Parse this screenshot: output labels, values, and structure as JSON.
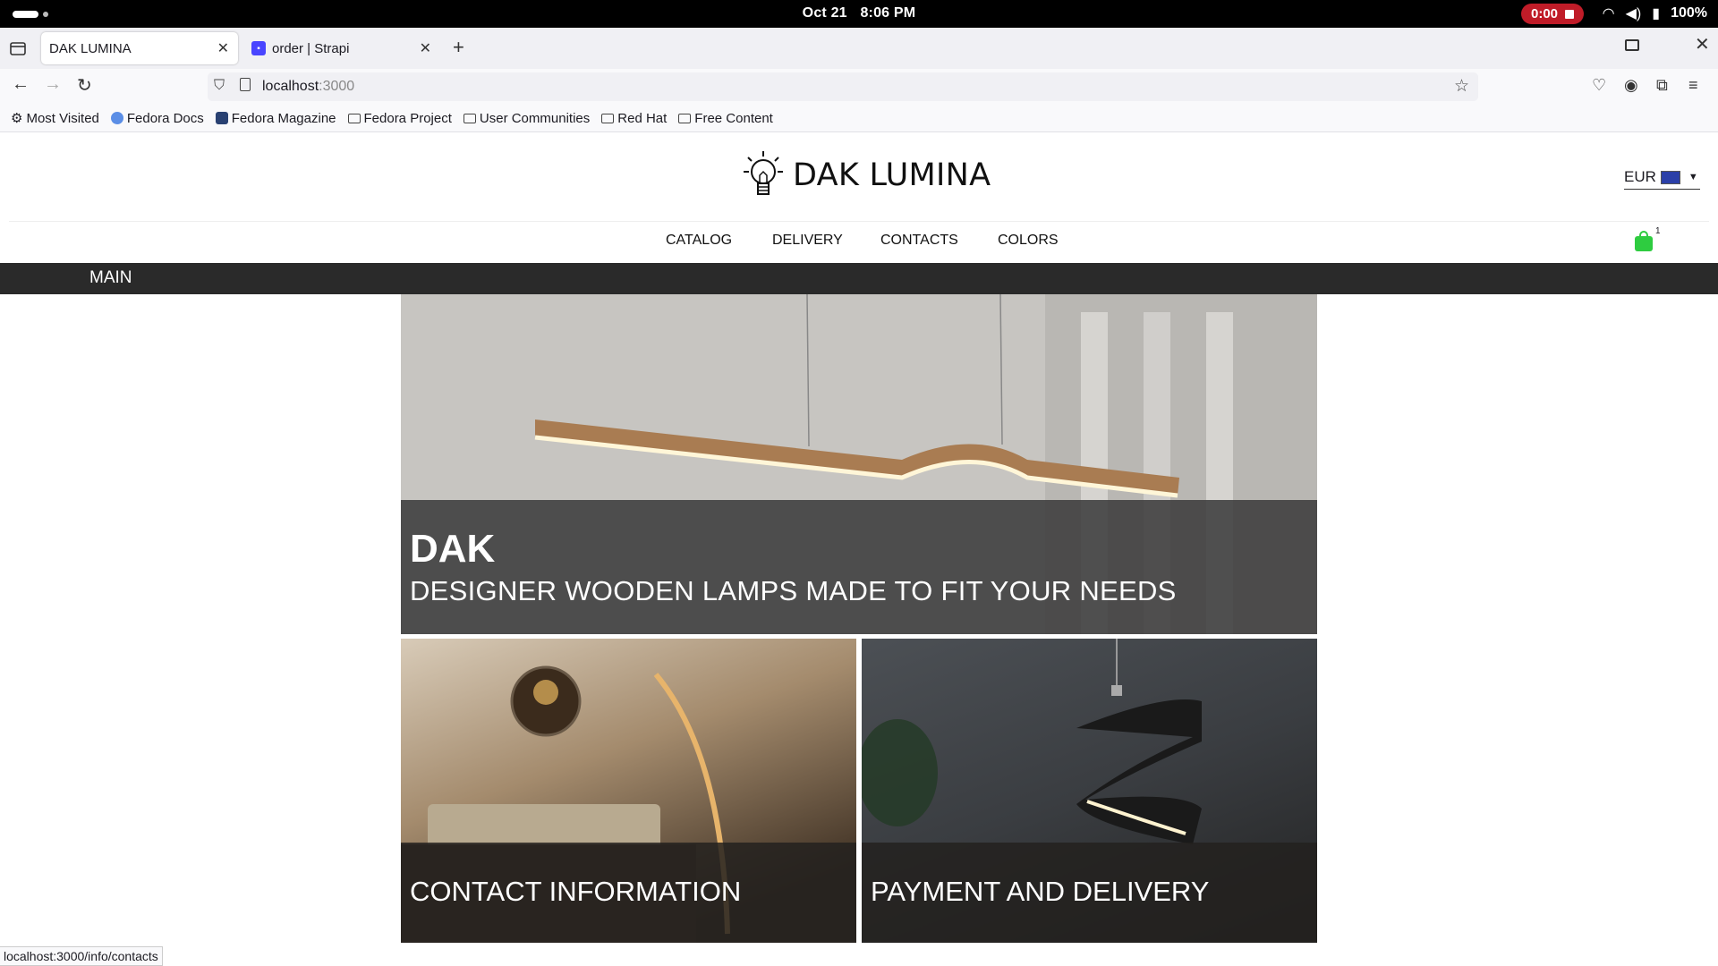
{
  "system": {
    "date": "Oct 21",
    "time": "8:06 PM",
    "recording": "0:00",
    "battery": "100%"
  },
  "browser": {
    "tabs": [
      {
        "title": "DAK LUMINA",
        "active": true
      },
      {
        "title": "order | Strapi",
        "active": false
      }
    ],
    "url": {
      "host": "localhost",
      "port": ":3000"
    },
    "bookmarks": [
      "Most Visited",
      "Fedora Docs",
      "Fedora Magazine",
      "Fedora Project",
      "User Communities",
      "Red Hat",
      "Free Content"
    ],
    "status_url": "localhost:3000/info/contacts"
  },
  "site": {
    "brand": "DAK LUMINA",
    "currency": "EUR",
    "nav": [
      "CATALOG",
      "DELIVERY",
      "CONTACTS",
      "COLORS"
    ],
    "cart_count": "1",
    "section": "MAIN",
    "hero": {
      "title": "DAK",
      "subtitle": "DESIGNER WOODEN LAMPS MADE TO FIT YOUR NEEDS"
    },
    "cards": [
      "CONTACT INFORMATION",
      "PAYMENT AND DELIVERY"
    ]
  },
  "colors": {
    "accent_cart": "#2ecc40",
    "main_bar": "#2a2a2a",
    "record": "#c01c28"
  }
}
